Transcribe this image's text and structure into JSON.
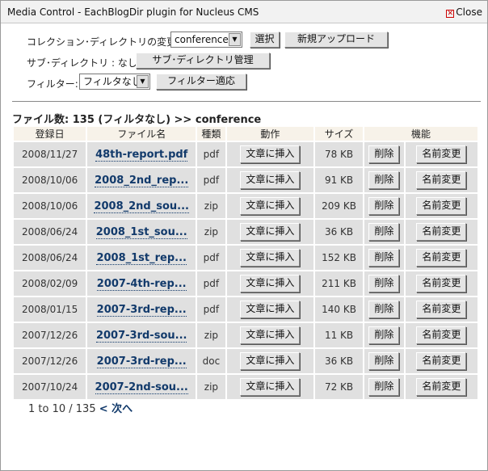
{
  "window": {
    "title": "Media Control - EachBlogDir plugin for Nucleus CMS",
    "close_label": "Close"
  },
  "controls": {
    "collection_label": "コレクション･ディレクトリの変更 :",
    "collection_value": "conference",
    "select_button": "選択",
    "upload_button": "新規アップロード",
    "subdir_label": "サブ･ディレクトリ : なし",
    "subdir_button": "サブ･ディレクトリ管理",
    "filter_label": "フィルター:",
    "filter_value": "フィルタなし",
    "filter_apply_button": "フィルター適応"
  },
  "summary": {
    "count_text": "ファイル数: 135 (フィルタなし) >> ",
    "dir_name": "conference"
  },
  "table": {
    "headers": {
      "date": "登録日",
      "name": "ファイル名",
      "type": "種類",
      "action": "動作",
      "size": "サイズ",
      "functions": "機能"
    },
    "insert_label": "文章に挿入",
    "delete_label": "削除",
    "rename_label": "名前変更",
    "rows": [
      {
        "date": "2008/11/27",
        "name": "48th-report.pdf",
        "type": "pdf",
        "size": "78 KB"
      },
      {
        "date": "2008/10/06",
        "name": "2008_2nd_rep...",
        "type": "pdf",
        "size": "91 KB"
      },
      {
        "date": "2008/10/06",
        "name": "2008_2nd_sou...",
        "type": "zip",
        "size": "209 KB"
      },
      {
        "date": "2008/06/24",
        "name": "2008_1st_sou...",
        "type": "zip",
        "size": "36 KB"
      },
      {
        "date": "2008/06/24",
        "name": "2008_1st_rep...",
        "type": "pdf",
        "size": "152 KB"
      },
      {
        "date": "2008/02/09",
        "name": "2007-4th-rep...",
        "type": "pdf",
        "size": "211 KB"
      },
      {
        "date": "2008/01/15",
        "name": "2007-3rd-rep...",
        "type": "pdf",
        "size": "140 KB"
      },
      {
        "date": "2007/12/26",
        "name": "2007-3rd-sou...",
        "type": "zip",
        "size": "11 KB"
      },
      {
        "date": "2007/12/26",
        "name": "2007-3rd-rep...",
        "type": "doc",
        "size": "36 KB"
      },
      {
        "date": "2007/10/24",
        "name": "2007-2nd-sou...",
        "type": "zip",
        "size": "72 KB"
      }
    ]
  },
  "pager": {
    "range_text": "1 to 10 / 135",
    "next_label": "< 次へ"
  }
}
